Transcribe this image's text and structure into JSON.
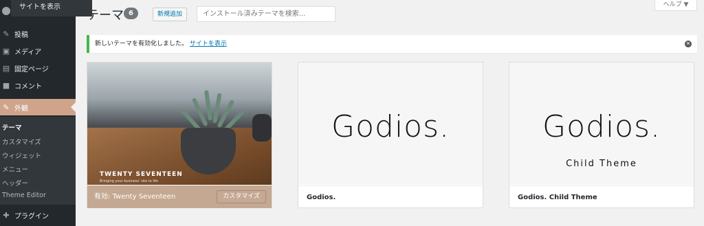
{
  "tooltip": {
    "label": "サイトを表示"
  },
  "menu": {
    "posts": "投稿",
    "media": "メディア",
    "pages": "固定ページ",
    "comments": "コメント",
    "appearance": "外観",
    "plugins": "プラグイン"
  },
  "submenu": [
    "テーマ",
    "カスタマイズ",
    "ウィジェット",
    "メニュー",
    "ヘッダー",
    "Theme Editor"
  ],
  "header": {
    "title": "テーマ",
    "count": "6",
    "add_new": "新規追加",
    "search_placeholder": "インストール済みテーマを検索...",
    "help": "ヘルプ ▼"
  },
  "notice": {
    "text": "新しいテーマを有効化しました。",
    "link": "サイトを表示"
  },
  "themes": [
    {
      "name": "Twenty Seventeen",
      "active_label": "有効:",
      "customize": "カスタマイズ",
      "screenshot_title": "TWENTY SEVENTEEN",
      "screenshot_sub": "Bringing your business' site to life"
    },
    {
      "name": "Godios.",
      "logo": "Godios."
    },
    {
      "name": "Godios. Child Theme",
      "logo": "Godios.",
      "logo_sub": "Child Theme"
    }
  ],
  "colors": {
    "accent": "#cfa48b",
    "sidebar": "#23282d",
    "notice_border": "#46b450",
    "link": "#0073aa"
  }
}
